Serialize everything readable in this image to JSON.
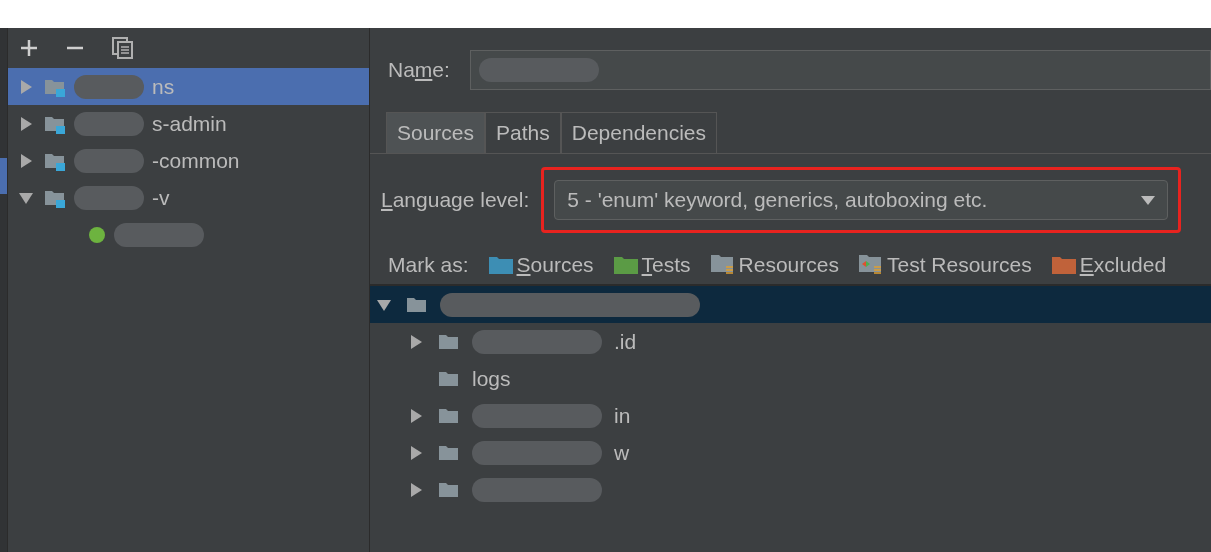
{
  "left_panel": {
    "toolbar": [
      {
        "kind": "add"
      },
      {
        "kind": "remove"
      },
      {
        "kind": "copy"
      }
    ],
    "modules": [
      {
        "label": "ns",
        "expanded": false,
        "selected": true,
        "redacted": true
      },
      {
        "label": "s-admin",
        "expanded": false,
        "selected": false,
        "redacted": true
      },
      {
        "label": "-common",
        "expanded": false,
        "selected": false,
        "redacted": true
      },
      {
        "label": "-v",
        "expanded": true,
        "selected": false,
        "redacted": true,
        "children": [
          {
            "kind": "spring",
            "redacted": true
          }
        ]
      }
    ]
  },
  "name_field": {
    "label": {
      "before": "Na",
      "mnemonic": "m",
      "after": "e:"
    },
    "redacted": true
  },
  "tabs": [
    {
      "label": "Sources",
      "selected": true
    },
    {
      "label": "Paths",
      "selected": false
    },
    {
      "label": "Dependencies",
      "selected": false
    }
  ],
  "language_level": {
    "label": {
      "mnemonic": "L",
      "after": "anguage level:"
    },
    "value": "5 - 'enum' keyword, generics, autoboxing etc.",
    "highlighted": true
  },
  "mark_as": {
    "label": "Mark as:",
    "items": [
      {
        "kind": "sources",
        "label": {
          "mnemonic": "S",
          "after": "ources"
        },
        "color": "#3d8eb4"
      },
      {
        "kind": "tests",
        "label": {
          "mnemonic": "T",
          "after": "ests"
        },
        "color": "#5b9b45"
      },
      {
        "kind": "resources",
        "label": {
          "after": "Resources"
        },
        "color": "#87939a"
      },
      {
        "kind": "test_resources",
        "label": {
          "after": "Test Resources"
        },
        "color": "#87939a"
      },
      {
        "kind": "excluded",
        "label": {
          "mnemonic": "E",
          "after": "xcluded"
        },
        "color": "#c0623a"
      }
    ]
  },
  "content_tree": {
    "root": {
      "expanded": true,
      "selected": true,
      "redacted": true
    },
    "children": [
      {
        "label": ".id",
        "expandable": true,
        "redacted": true
      },
      {
        "label": "logs",
        "expandable": false,
        "redacted": false
      },
      {
        "label": "in",
        "expandable": true,
        "redacted": true
      },
      {
        "label": "w",
        "expandable": true,
        "redacted": true
      },
      {
        "expandable": true,
        "redacted": true
      }
    ]
  }
}
